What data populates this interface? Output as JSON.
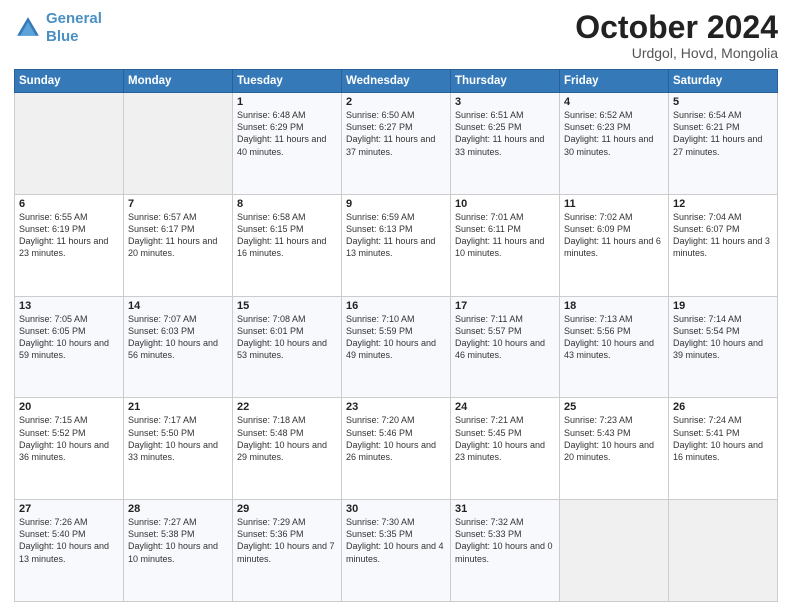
{
  "logo": {
    "line1": "General",
    "line2": "Blue"
  },
  "header": {
    "title": "October 2024",
    "subtitle": "Urdgol, Hovd, Mongolia"
  },
  "weekdays": [
    "Sunday",
    "Monday",
    "Tuesday",
    "Wednesday",
    "Thursday",
    "Friday",
    "Saturday"
  ],
  "weeks": [
    [
      {
        "day": "",
        "sunrise": "",
        "sunset": "",
        "daylight": ""
      },
      {
        "day": "",
        "sunrise": "",
        "sunset": "",
        "daylight": ""
      },
      {
        "day": "1",
        "sunrise": "Sunrise: 6:48 AM",
        "sunset": "Sunset: 6:29 PM",
        "daylight": "Daylight: 11 hours and 40 minutes."
      },
      {
        "day": "2",
        "sunrise": "Sunrise: 6:50 AM",
        "sunset": "Sunset: 6:27 PM",
        "daylight": "Daylight: 11 hours and 37 minutes."
      },
      {
        "day": "3",
        "sunrise": "Sunrise: 6:51 AM",
        "sunset": "Sunset: 6:25 PM",
        "daylight": "Daylight: 11 hours and 33 minutes."
      },
      {
        "day": "4",
        "sunrise": "Sunrise: 6:52 AM",
        "sunset": "Sunset: 6:23 PM",
        "daylight": "Daylight: 11 hours and 30 minutes."
      },
      {
        "day": "5",
        "sunrise": "Sunrise: 6:54 AM",
        "sunset": "Sunset: 6:21 PM",
        "daylight": "Daylight: 11 hours and 27 minutes."
      }
    ],
    [
      {
        "day": "6",
        "sunrise": "Sunrise: 6:55 AM",
        "sunset": "Sunset: 6:19 PM",
        "daylight": "Daylight: 11 hours and 23 minutes."
      },
      {
        "day": "7",
        "sunrise": "Sunrise: 6:57 AM",
        "sunset": "Sunset: 6:17 PM",
        "daylight": "Daylight: 11 hours and 20 minutes."
      },
      {
        "day": "8",
        "sunrise": "Sunrise: 6:58 AM",
        "sunset": "Sunset: 6:15 PM",
        "daylight": "Daylight: 11 hours and 16 minutes."
      },
      {
        "day": "9",
        "sunrise": "Sunrise: 6:59 AM",
        "sunset": "Sunset: 6:13 PM",
        "daylight": "Daylight: 11 hours and 13 minutes."
      },
      {
        "day": "10",
        "sunrise": "Sunrise: 7:01 AM",
        "sunset": "Sunset: 6:11 PM",
        "daylight": "Daylight: 11 hours and 10 minutes."
      },
      {
        "day": "11",
        "sunrise": "Sunrise: 7:02 AM",
        "sunset": "Sunset: 6:09 PM",
        "daylight": "Daylight: 11 hours and 6 minutes."
      },
      {
        "day": "12",
        "sunrise": "Sunrise: 7:04 AM",
        "sunset": "Sunset: 6:07 PM",
        "daylight": "Daylight: 11 hours and 3 minutes."
      }
    ],
    [
      {
        "day": "13",
        "sunrise": "Sunrise: 7:05 AM",
        "sunset": "Sunset: 6:05 PM",
        "daylight": "Daylight: 10 hours and 59 minutes."
      },
      {
        "day": "14",
        "sunrise": "Sunrise: 7:07 AM",
        "sunset": "Sunset: 6:03 PM",
        "daylight": "Daylight: 10 hours and 56 minutes."
      },
      {
        "day": "15",
        "sunrise": "Sunrise: 7:08 AM",
        "sunset": "Sunset: 6:01 PM",
        "daylight": "Daylight: 10 hours and 53 minutes."
      },
      {
        "day": "16",
        "sunrise": "Sunrise: 7:10 AM",
        "sunset": "Sunset: 5:59 PM",
        "daylight": "Daylight: 10 hours and 49 minutes."
      },
      {
        "day": "17",
        "sunrise": "Sunrise: 7:11 AM",
        "sunset": "Sunset: 5:57 PM",
        "daylight": "Daylight: 10 hours and 46 minutes."
      },
      {
        "day": "18",
        "sunrise": "Sunrise: 7:13 AM",
        "sunset": "Sunset: 5:56 PM",
        "daylight": "Daylight: 10 hours and 43 minutes."
      },
      {
        "day": "19",
        "sunrise": "Sunrise: 7:14 AM",
        "sunset": "Sunset: 5:54 PM",
        "daylight": "Daylight: 10 hours and 39 minutes."
      }
    ],
    [
      {
        "day": "20",
        "sunrise": "Sunrise: 7:15 AM",
        "sunset": "Sunset: 5:52 PM",
        "daylight": "Daylight: 10 hours and 36 minutes."
      },
      {
        "day": "21",
        "sunrise": "Sunrise: 7:17 AM",
        "sunset": "Sunset: 5:50 PM",
        "daylight": "Daylight: 10 hours and 33 minutes."
      },
      {
        "day": "22",
        "sunrise": "Sunrise: 7:18 AM",
        "sunset": "Sunset: 5:48 PM",
        "daylight": "Daylight: 10 hours and 29 minutes."
      },
      {
        "day": "23",
        "sunrise": "Sunrise: 7:20 AM",
        "sunset": "Sunset: 5:46 PM",
        "daylight": "Daylight: 10 hours and 26 minutes."
      },
      {
        "day": "24",
        "sunrise": "Sunrise: 7:21 AM",
        "sunset": "Sunset: 5:45 PM",
        "daylight": "Daylight: 10 hours and 23 minutes."
      },
      {
        "day": "25",
        "sunrise": "Sunrise: 7:23 AM",
        "sunset": "Sunset: 5:43 PM",
        "daylight": "Daylight: 10 hours and 20 minutes."
      },
      {
        "day": "26",
        "sunrise": "Sunrise: 7:24 AM",
        "sunset": "Sunset: 5:41 PM",
        "daylight": "Daylight: 10 hours and 16 minutes."
      }
    ],
    [
      {
        "day": "27",
        "sunrise": "Sunrise: 7:26 AM",
        "sunset": "Sunset: 5:40 PM",
        "daylight": "Daylight: 10 hours and 13 minutes."
      },
      {
        "day": "28",
        "sunrise": "Sunrise: 7:27 AM",
        "sunset": "Sunset: 5:38 PM",
        "daylight": "Daylight: 10 hours and 10 minutes."
      },
      {
        "day": "29",
        "sunrise": "Sunrise: 7:29 AM",
        "sunset": "Sunset: 5:36 PM",
        "daylight": "Daylight: 10 hours and 7 minutes."
      },
      {
        "day": "30",
        "sunrise": "Sunrise: 7:30 AM",
        "sunset": "Sunset: 5:35 PM",
        "daylight": "Daylight: 10 hours and 4 minutes."
      },
      {
        "day": "31",
        "sunrise": "Sunrise: 7:32 AM",
        "sunset": "Sunset: 5:33 PM",
        "daylight": "Daylight: 10 hours and 0 minutes."
      },
      {
        "day": "",
        "sunrise": "",
        "sunset": "",
        "daylight": ""
      },
      {
        "day": "",
        "sunrise": "",
        "sunset": "",
        "daylight": ""
      }
    ]
  ]
}
